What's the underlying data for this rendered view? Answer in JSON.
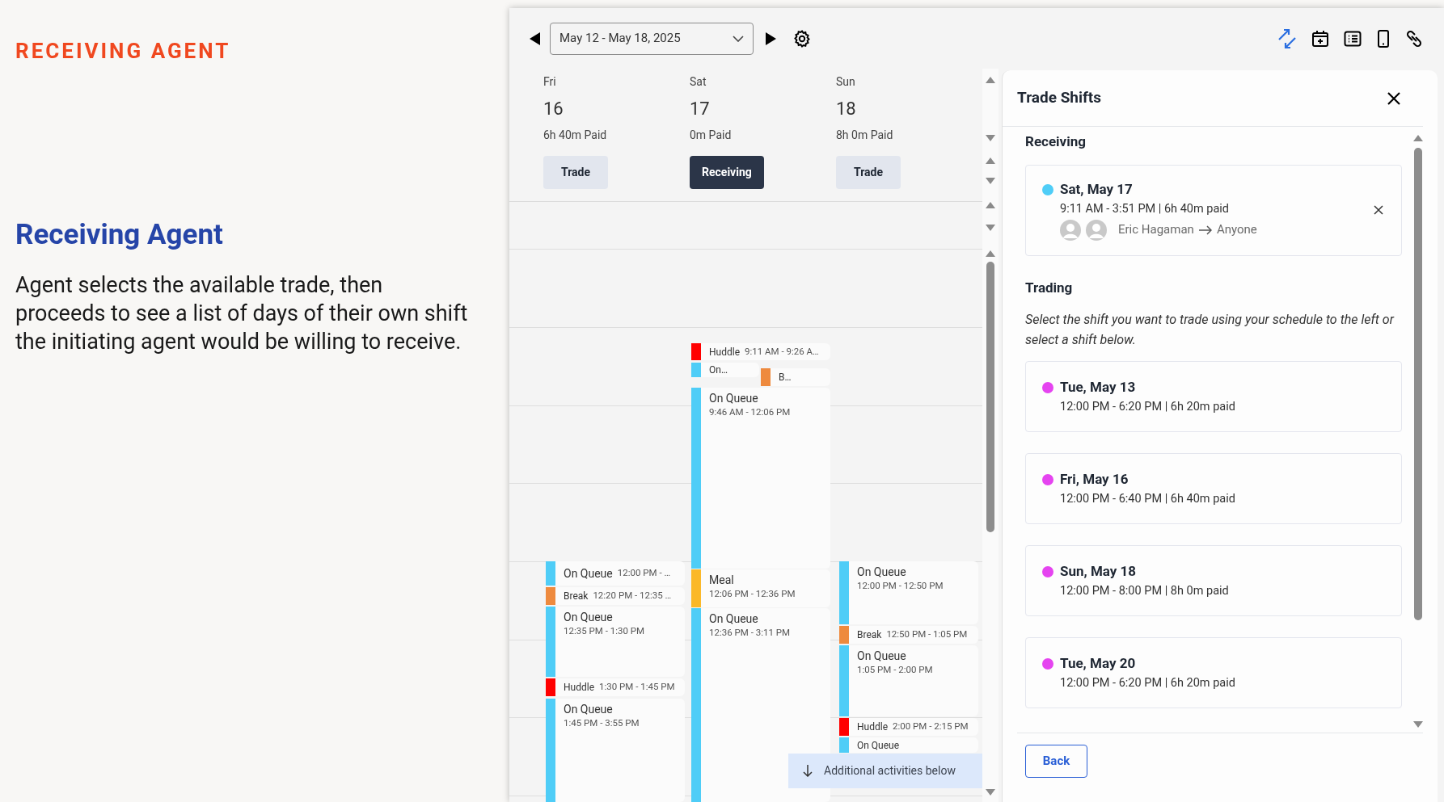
{
  "intro": {
    "eyebrow": "RECEIVING AGENT",
    "heading": "Receiving Agent",
    "body": "Agent selects the available trade, then proceeds to see a list of days of their own shift the initiating agent would be willing to receive."
  },
  "toolbar": {
    "date_range": "May 12 - May 18, 2025"
  },
  "days": [
    {
      "weekday": "Fri",
      "date": "16",
      "paid": "6h 40m Paid",
      "action": "Trade",
      "selected": false,
      "events": [
        {
          "kind": "inline",
          "label": "On Queue",
          "time": "12:00 PM - …",
          "color": "#4fcdf7"
        },
        {
          "kind": "inline",
          "label": "Break",
          "time": "12:20 PM - 12:35 …",
          "color": "#ee8a3e"
        },
        {
          "kind": "stacked",
          "label": "On Queue",
          "time": "12:35 PM - 1:30 PM",
          "color": "#4fcdf7"
        },
        {
          "kind": "inline",
          "label": "Huddle",
          "time": "1:30 PM - 1:45 PM",
          "color": "#ff0000"
        },
        {
          "kind": "stacked",
          "label": "On Queue",
          "time": "1:45 PM - 3:55 PM",
          "color": "#4fcdf7"
        }
      ]
    },
    {
      "weekday": "Sat",
      "date": "17",
      "paid": "0m Paid",
      "action": "Receiving",
      "selected": true,
      "events": [
        {
          "kind": "inline",
          "label": "Huddle",
          "time": "9:11 AM - 9:26 A…",
          "color": "#ff0000"
        },
        {
          "kind": "inline",
          "label": "On…",
          "color": "#4fcdf7"
        },
        {
          "kind": "inline",
          "label": "B…",
          "color": "#ee8a3e"
        },
        {
          "kind": "stacked",
          "label": "On Queue",
          "time": "9:46 AM - 12:06 PM",
          "color": "#4fcdf7"
        },
        {
          "kind": "stacked",
          "label": "Meal",
          "time": "12:06 PM - 12:36 PM",
          "color": "#fbb829"
        },
        {
          "kind": "stacked",
          "label": "On Queue",
          "time": "12:36 PM - 3:11 PM",
          "color": "#4fcdf7"
        }
      ]
    },
    {
      "weekday": "Sun",
      "date": "18",
      "paid": "8h 0m Paid",
      "action": "Trade",
      "selected": false,
      "events": [
        {
          "kind": "stacked",
          "label": "On Queue",
          "time": "12:00 PM - 12:50 PM",
          "color": "#4fcdf7"
        },
        {
          "kind": "inline",
          "label": "Break",
          "time": "12:50 PM - 1:05 PM",
          "color": "#ee8a3e"
        },
        {
          "kind": "stacked",
          "label": "On Queue",
          "time": "1:05 PM - 2:00 PM",
          "color": "#4fcdf7"
        },
        {
          "kind": "inline",
          "label": "Huddle",
          "time": "2:00 PM - 2:15 PM",
          "color": "#ff0000"
        },
        {
          "kind": "inline",
          "label": "On Queue",
          "color": "#4fcdf7"
        }
      ]
    }
  ],
  "banner": "Additional activities below",
  "trade_panel": {
    "title": "Trade Shifts",
    "receiving_heading": "Receiving",
    "receiving_shift": {
      "date": "Sat, May 17",
      "detail": "9:11 AM - 3:51 PM | 6h 40m paid",
      "from": "Eric Hagaman",
      "to": "Anyone",
      "color": "#4fcdf7"
    },
    "trading_heading": "Trading",
    "instructions": "Select the shift you want to trade using your schedule to the left or select a shift below.",
    "shifts": [
      {
        "date": "Tue, May 13",
        "detail": "12:00 PM - 6:20 PM | 6h 20m paid",
        "color": "#e544f0"
      },
      {
        "date": "Fri, May 16",
        "detail": "12:00 PM - 6:40 PM | 6h 40m paid",
        "color": "#e544f0"
      },
      {
        "date": "Sun, May 18",
        "detail": "12:00 PM - 8:00 PM | 8h 0m paid",
        "color": "#e544f0"
      },
      {
        "date": "Tue, May 20",
        "detail": "12:00 PM - 6:20 PM | 6h 20m paid",
        "color": "#e544f0"
      }
    ],
    "back": "Back"
  }
}
